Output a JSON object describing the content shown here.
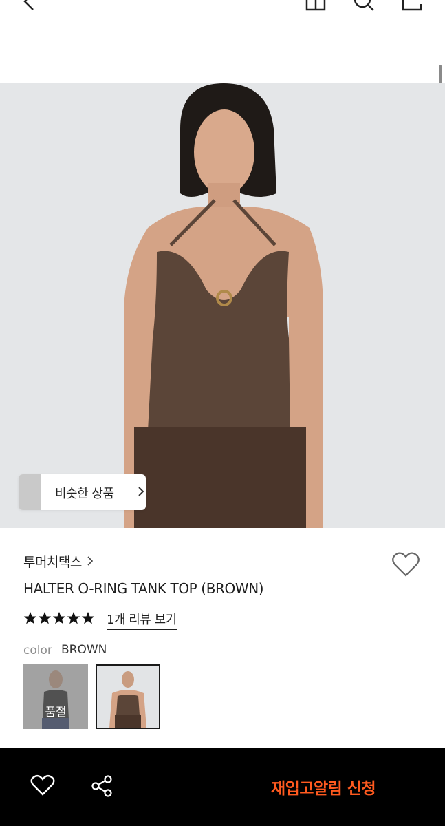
{
  "header": {
    "back_icon": "chevron-left-icon",
    "actions": [
      "store-icon",
      "search-icon",
      "share-box-icon"
    ]
  },
  "hero": {
    "image": "model-wearing-brown-halter-top",
    "similar_products_label": "비슷한 상품"
  },
  "product": {
    "brand": "투머치택스",
    "title": "HALTER O-RING TANK TOP (BROWN)",
    "rating_stars": 5,
    "review_link": "1개 리뷰 보기",
    "color_label": "color",
    "color_value": "BROWN",
    "swatches": [
      {
        "name": "black",
        "sold_out_label": "품절"
      },
      {
        "name": "brown",
        "selected": true
      }
    ]
  },
  "bottom_bar": {
    "wishlist_icon": "heart-outline-icon",
    "share_icon": "share-icon",
    "restock_button": "재입고알림 신청"
  },
  "colors": {
    "accent": "#ff5a1f",
    "bottom_bar_bg": "#000000"
  }
}
